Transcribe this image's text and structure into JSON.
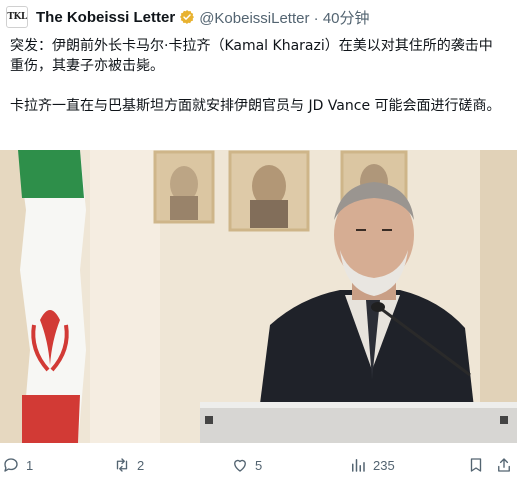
{
  "account": {
    "avatar_text": "TKL",
    "display_name": "The Kobeissi Letter",
    "handle_time": "@KobeissiLetter · 40分钟"
  },
  "tweet": {
    "paragraph1": "突发：伊朗前外长卡马尔·卡拉齐（Kamal Kharazi）在美以对其住所的袭击中重伤，其妻子亦被击毙。",
    "paragraph2": "卡拉齐一直在与巴基斯坦方面就安排伊朗官员与 JD Vance 可能会面进行磋商。"
  },
  "actions": {
    "replies": "1",
    "reposts": "2",
    "likes": "5",
    "views": "235"
  },
  "colors": {
    "verified_badge": "#e8b230",
    "muted_text": "#536471",
    "primary_text": "#0f1419"
  },
  "icons": [
    "reply-icon",
    "repost-icon",
    "like-icon",
    "views-icon",
    "bookmark-icon",
    "share-icon",
    "verified-badge-icon"
  ]
}
